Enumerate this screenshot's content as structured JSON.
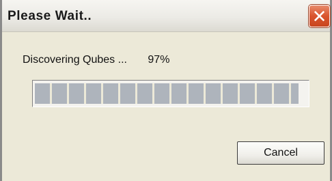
{
  "window": {
    "title": "Please Wait..",
    "close_glyph": "✕"
  },
  "progress": {
    "status_text": "Discovering Qubes ...",
    "percent_text": "97%",
    "fraction": 0.97
  },
  "buttons": {
    "cancel_label": "Cancel"
  },
  "icons": {
    "close": "close-icon"
  },
  "colors": {
    "dialog_bg": "#ece9d8",
    "progress_segment": "#aeb4bc",
    "close_button": "#d9542d"
  }
}
